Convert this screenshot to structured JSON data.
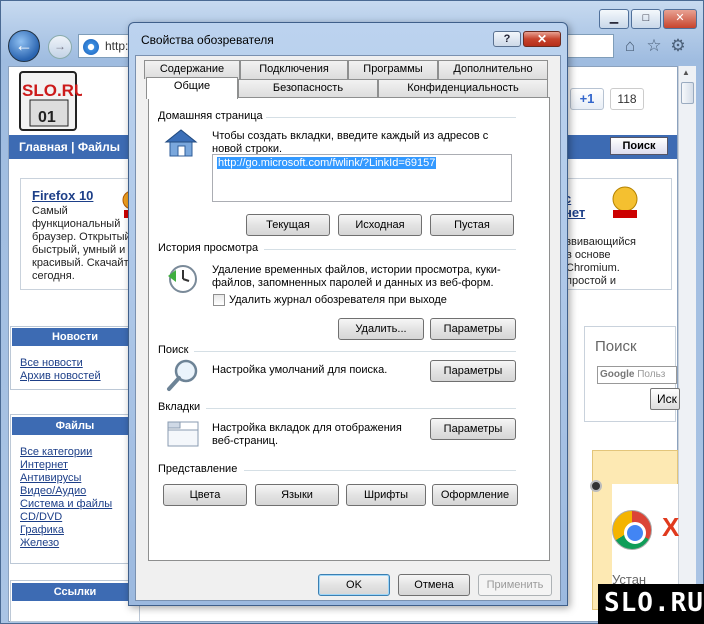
{
  "browser": {
    "address_text": "http:",
    "window_buttons": {
      "minimize": "▁",
      "maximize": "□",
      "close": "✕"
    },
    "toolbar_icons": [
      "home-icon",
      "star-icon",
      "gear-icon"
    ],
    "like_label": "+1",
    "like_count": "118"
  },
  "page": {
    "logo_text": "SLO.RU",
    "logo_sub": "01",
    "nav_text": "Главная | Файлы",
    "search_button": "Поиск",
    "firefox_card": {
      "title": "Firefox 10",
      "desc": "Самый функциональный браузер. Открытый быстрый, умный и красивый. Скачайте сегодня."
    },
    "chrome_card": {
      "title_fragment": "с\nнет",
      "desc": "звивающийся\nв основе\nChromium.\nпростой и"
    },
    "news": {
      "header": "Новости",
      "links": [
        "Все новости",
        "Архив новостей"
      ]
    },
    "files": {
      "header": "Файлы",
      "links": [
        "Все категории",
        "Интернет",
        "Антивирусы",
        "Видео/Аудио",
        "Система и файлы",
        "CD/DVD",
        "Графика",
        "Железо"
      ]
    },
    "links_header": "Ссылки",
    "search_widget": {
      "title": "Поиск",
      "input_brand": "Google",
      "input_placeholder": "Польз",
      "button": "Иск"
    },
    "ad": {
      "letter": "Х",
      "text": "Устан"
    },
    "watermark": "SLO.RU"
  },
  "dialog": {
    "title": "Свойства обозревателя",
    "help_button": "?",
    "close_button": "✕",
    "tabs_row1": [
      "Содержание",
      "Подключения",
      "Программы",
      "Дополнительно"
    ],
    "tabs_row2": [
      "Общие",
      "Безопасность",
      "Конфиденциальность"
    ],
    "active_tab": "Общие",
    "home": {
      "section": "Домашняя страница",
      "hint": "Чтобы создать вкладки, введите каждый из адресов с новой строки.",
      "url": "http://go.microsoft.com/fwlink/?LinkId=69157",
      "buttons": [
        "Текущая",
        "Исходная",
        "Пустая"
      ]
    },
    "history": {
      "section": "История просмотра",
      "desc": "Удаление временных файлов, истории просмотра, куки-файлов, запомненных паролей и данных из веб-форм.",
      "checkbox_label": "Удалить журнал обозревателя при выходе",
      "checkbox_checked": false,
      "delete_button": "Удалить...",
      "settings_button": "Параметры"
    },
    "search": {
      "section": "Поиск",
      "desc": "Настройка умолчаний для поиска.",
      "settings_button": "Параметры"
    },
    "tabs_sect": {
      "section": "Вкладки",
      "desc": "Настройка вкладок для отображения веб-страниц.",
      "settings_button": "Параметры"
    },
    "appearance": {
      "section": "Представление",
      "buttons": [
        "Цвета",
        "Языки",
        "Шрифты",
        "Оформление"
      ]
    },
    "footer": {
      "ok": "OK",
      "cancel": "Отмена",
      "apply": "Применить"
    }
  }
}
